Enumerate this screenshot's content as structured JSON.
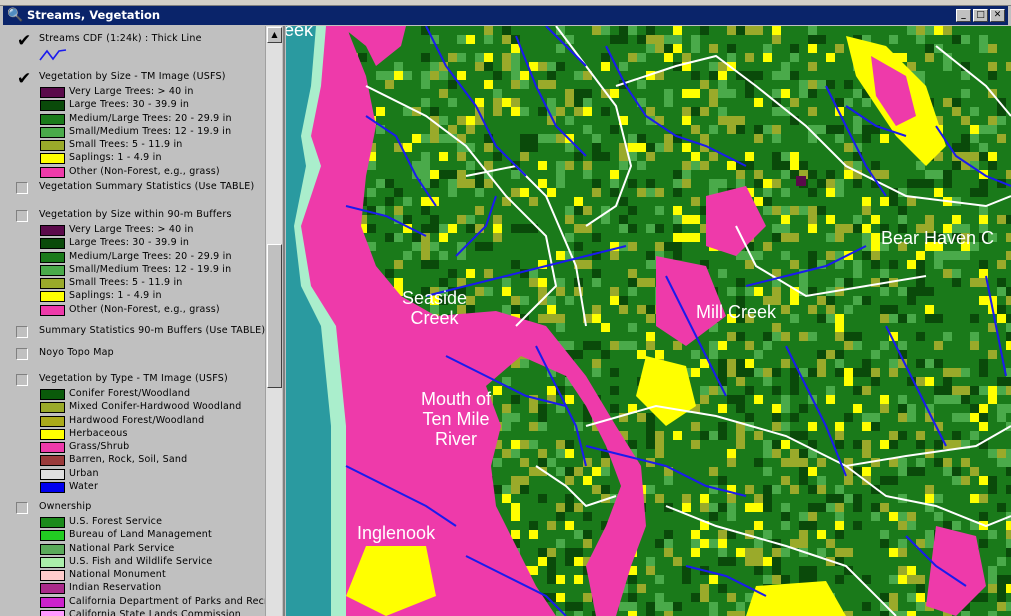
{
  "window": {
    "title": "Streams, Vegetation",
    "buttons": {
      "minimize": "_",
      "maximize": "□",
      "close": "✕"
    }
  },
  "legend": {
    "themes": [
      {
        "name": "Streams CDF (1:24k) : Thick Line",
        "checked": true,
        "line_symbol": true,
        "items": []
      },
      {
        "name": "Vegetation by Size - TM Image (USFS)",
        "checked": true,
        "items": [
          {
            "label": "Very Large Trees: > 40  in",
            "color": "#5a0a4a"
          },
          {
            "label": "Large Trees: 30 - 39.9 in",
            "color": "#0a4a0a"
          },
          {
            "label": "Medium/Large Trees: 20 - 29.9 in",
            "color": "#1a7a1a"
          },
          {
            "label": "Small/Medium Trees: 12 - 19.9 in",
            "color": "#4aaa4a"
          },
          {
            "label": "Small Trees: 5 - 11.9 in",
            "color": "#9aaa2a"
          },
          {
            "label": "Saplings: 1 - 4.9 in",
            "color": "#ffff00"
          },
          {
            "label": "Other (Non-Forest, e.g., grass)",
            "color": "#ee3aaa"
          }
        ]
      },
      {
        "name": "Vegetation Summary Statistics (Use TABLE)",
        "checked": false,
        "items": []
      },
      {
        "name": "Vegetation by Size within 90-m Buffers",
        "checked": false,
        "items": [
          {
            "label": "Very Large Trees: > 40  in",
            "color": "#5a0a4a"
          },
          {
            "label": "Large Trees: 30 - 39.9 in",
            "color": "#0a4a0a"
          },
          {
            "label": "Medium/Large Trees: 20 - 29.9 in",
            "color": "#1a7a1a"
          },
          {
            "label": "Small/Medium Trees: 12 - 19.9 in",
            "color": "#4aaa4a"
          },
          {
            "label": "Small Trees: 5 - 11.9 in",
            "color": "#9aaa2a"
          },
          {
            "label": "Saplings: 1 - 4.9 in",
            "color": "#ffff00"
          },
          {
            "label": "Other (Non-Forest, e.g., grass)",
            "color": "#ee3aaa"
          }
        ]
      },
      {
        "name": "Summary Statistics 90-m Buffers (Use TABLE)",
        "checked": false,
        "items": []
      },
      {
        "name": "Noyo Topo Map",
        "checked": false,
        "items": []
      },
      {
        "name": "Vegetation by Type - TM Image (USFS)",
        "checked": false,
        "items": [
          {
            "label": "Conifer Forest/Woodland",
            "color": "#0a5a0a"
          },
          {
            "label": "Mixed Conifer-Hardwood Woodland",
            "color": "#9aaa2a"
          },
          {
            "label": "Hardwood Forest/Woodland",
            "color": "#aaaa1a"
          },
          {
            "label": "Herbaceous",
            "color": "#ffff00"
          },
          {
            "label": "Grass/Shrub",
            "color": "#ee3aaa"
          },
          {
            "label": "Barren, Rock, Soil, Sand",
            "color": "#9a3a3a"
          },
          {
            "label": "Urban",
            "color": "#e0e0e0"
          },
          {
            "label": "Water",
            "color": "#0000ee"
          }
        ]
      },
      {
        "name": "Ownership",
        "checked": false,
        "items": [
          {
            "label": "U.S. Forest Service",
            "color": "#1a8a1a"
          },
          {
            "label": "Bureau of Land Management",
            "color": "#22cc22"
          },
          {
            "label": "National Park Service",
            "color": "#5aaa5a"
          },
          {
            "label": "U.S. Fish and Wildlife Service",
            "color": "#aaeeaa"
          },
          {
            "label": "National Monument",
            "color": "#ffcccc"
          },
          {
            "label": "Indian Reservation",
            "color": "#aa2a8a"
          },
          {
            "label": "California Department of Parks and Recreation",
            "color": "#cc22cc"
          },
          {
            "label": "California State Lands Commission",
            "color": "#ff99ff"
          }
        ]
      }
    ]
  },
  "map": {
    "labels": {
      "top_left": "eek",
      "seaside": "Seaside\nCreek",
      "mill": "Mill Creek",
      "bear": "Bear Haven C",
      "mouth": "Mouth of\nTen Mile\nRiver",
      "inglenook": "Inglenook"
    },
    "colors": {
      "ocean": "#2a9aa0",
      "beach": "#aaeecc",
      "nonforest": "#ee3aaa",
      "saplings": "#ffff00",
      "small": "#9aaa2a",
      "smallmed": "#4aaa4a",
      "medlarge": "#1a7a1a",
      "large": "#0a4a0a",
      "verylarge": "#5a0a4a",
      "stream": "#1a1aee",
      "road": "#ffffff"
    }
  }
}
